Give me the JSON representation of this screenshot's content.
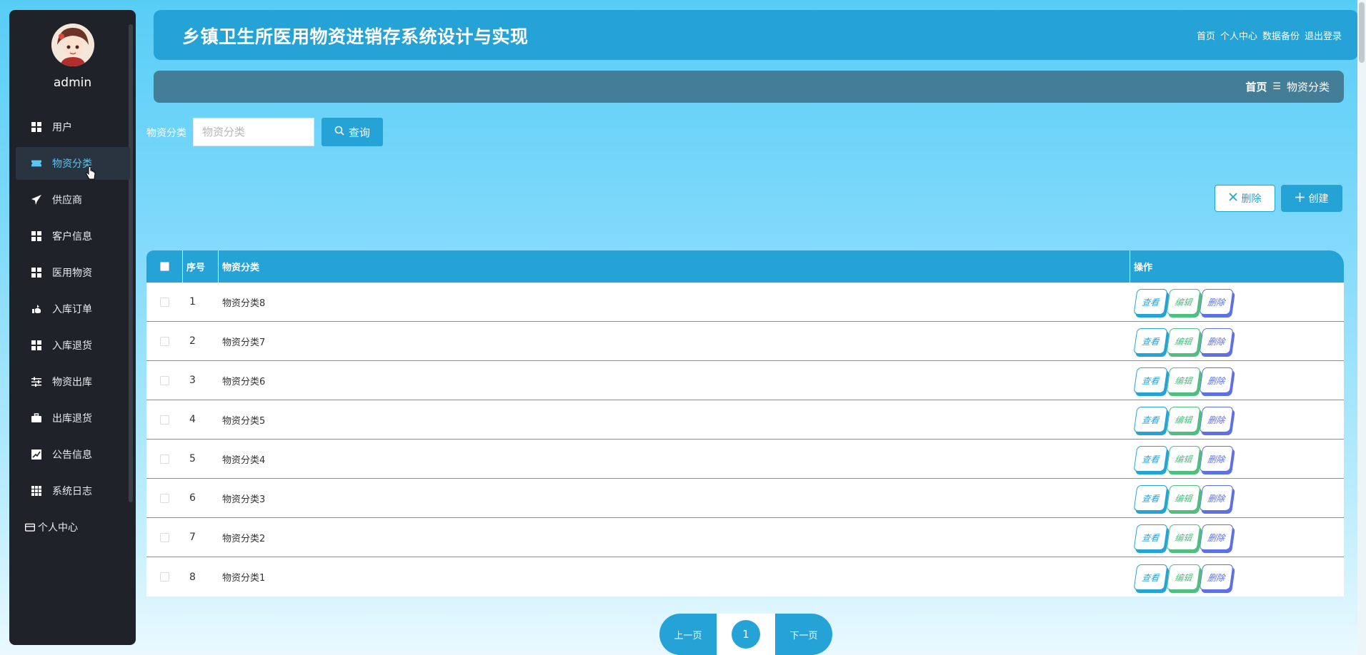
{
  "header": {
    "title": "乡镇卫生所医用物资进销存系统设计与实现",
    "nav": [
      "首页",
      "个人中心",
      "数据备份",
      "退出登录"
    ]
  },
  "sidebar": {
    "username": "admin",
    "items": [
      {
        "label": "用户",
        "icon": "grid-icon"
      },
      {
        "label": "物资分类",
        "icon": "ticket-icon",
        "active": true
      },
      {
        "label": "供应商",
        "icon": "send-icon"
      },
      {
        "label": "客户信息",
        "icon": "grid-icon"
      },
      {
        "label": "医用物资",
        "icon": "grid-icon"
      },
      {
        "label": "入库订单",
        "icon": "hand-icon"
      },
      {
        "label": "入库退货",
        "icon": "grid-icon"
      },
      {
        "label": "物资出库",
        "icon": "sliders-icon"
      },
      {
        "label": "出库退货",
        "icon": "briefcase-icon"
      },
      {
        "label": "公告信息",
        "icon": "chart-icon"
      },
      {
        "label": "系统日志",
        "icon": "table-icon"
      }
    ],
    "personal": "个人中心"
  },
  "breadcrumb": {
    "home": "首页",
    "separator": "☰",
    "current": "物资分类"
  },
  "search": {
    "label": "物资分类",
    "placeholder": "物资分类",
    "button": "查询"
  },
  "actions": {
    "delete": "删除",
    "create": "创建"
  },
  "table": {
    "headers": {
      "index": "序号",
      "name": "物资分类",
      "ops": "操作"
    },
    "rows": [
      {
        "index": "1",
        "name": "物资分类8"
      },
      {
        "index": "2",
        "name": "物资分类7"
      },
      {
        "index": "3",
        "name": "物资分类6"
      },
      {
        "index": "4",
        "name": "物资分类5"
      },
      {
        "index": "5",
        "name": "物资分类4"
      },
      {
        "index": "6",
        "name": "物资分类3"
      },
      {
        "index": "7",
        "name": "物资分类2"
      },
      {
        "index": "8",
        "name": "物资分类1"
      }
    ],
    "row_actions": {
      "view": "查看",
      "edit": "编辑",
      "delete": "删除"
    }
  },
  "pager": {
    "prev": "上一页",
    "current": "1",
    "next": "下一页"
  },
  "colors": {
    "primary": "#26a3d6",
    "sidebar": "#1f2329",
    "crumb": "#447d96",
    "edit": "#4fbf80",
    "delete": "#5d71e5"
  }
}
